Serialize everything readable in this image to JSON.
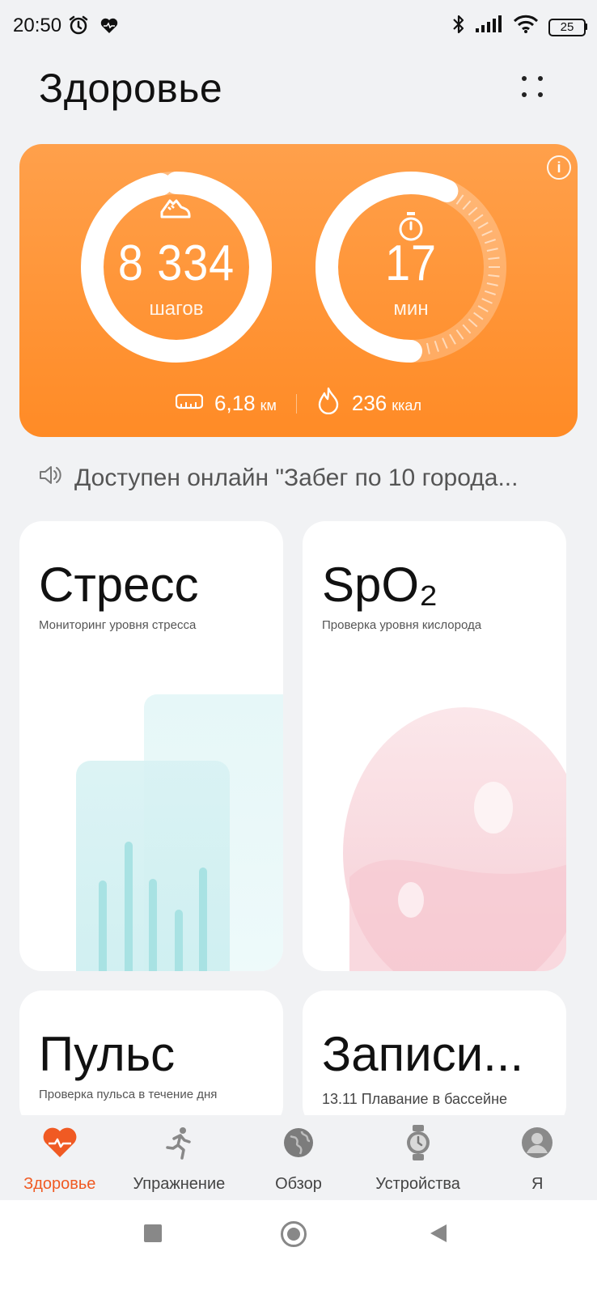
{
  "status_bar": {
    "time": "20:50",
    "icons": [
      "alarm-icon",
      "health-icon",
      "bluetooth-icon",
      "signal-icon",
      "wifi-icon"
    ],
    "battery": "25"
  },
  "header": {
    "title": "Здоровье",
    "menu_icon": "more-icon"
  },
  "activity": {
    "steps_value": "8 334",
    "steps_unit": "шагов",
    "steps_progress": 0.97,
    "minutes_value": "17",
    "minutes_unit": "мин",
    "minutes_progress": 0.57,
    "distance_value": "6,18",
    "distance_unit": "км",
    "calories_value": "236",
    "calories_unit": "ккал",
    "accent_color": "#ff8b26"
  },
  "announcement": {
    "text": "Доступен онлайн \"Забег по 10 города..."
  },
  "cards": {
    "stress": {
      "title": "Стресс",
      "subtitle": "Мониторинг уровня стресса"
    },
    "spo2": {
      "title": "SpO₂",
      "subtitle": "Проверка уровня кислорода"
    },
    "pulse": {
      "title": "Пульс",
      "subtitle": "Проверка пульса в течение дня"
    },
    "records": {
      "title": "Записи...",
      "subtitle": "13.11  Плавание в бассейне"
    }
  },
  "bottom_nav": {
    "items": [
      {
        "label": "Здоровье",
        "icon": "heart-icon",
        "active": true
      },
      {
        "label": "Упражнение",
        "icon": "runner-icon",
        "active": false
      },
      {
        "label": "Обзор",
        "icon": "globe-icon",
        "active": false
      },
      {
        "label": "Устройства",
        "icon": "watch-icon",
        "active": false
      },
      {
        "label": "Я",
        "icon": "profile-icon",
        "active": false
      }
    ],
    "active_color": "#f05a23"
  }
}
